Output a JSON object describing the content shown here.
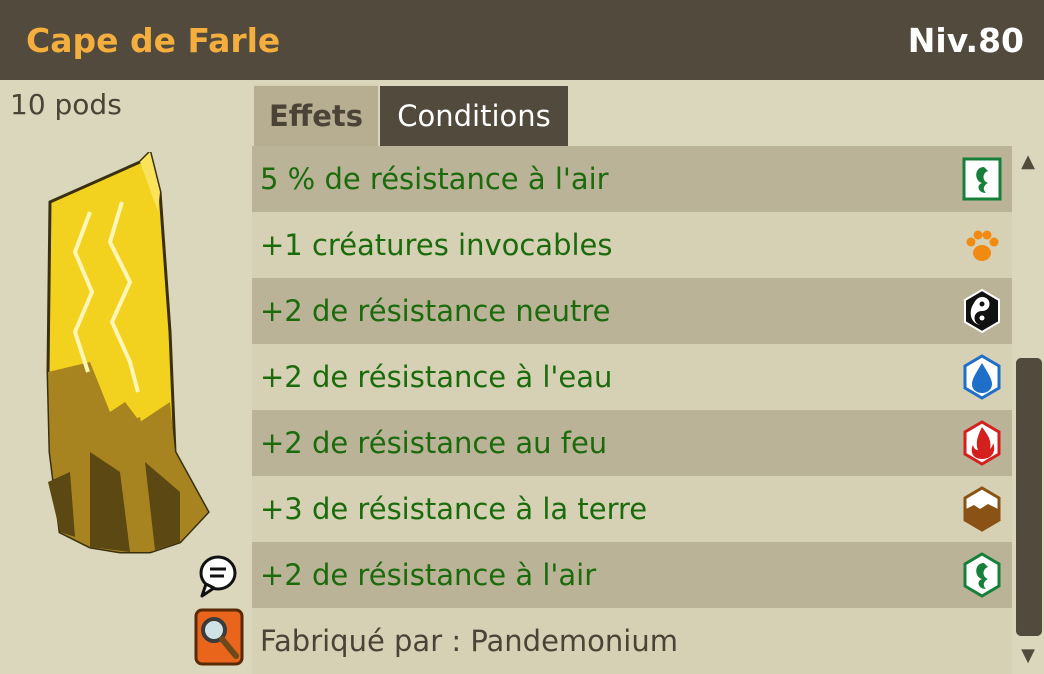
{
  "item": {
    "name": "Cape de Farle",
    "level": "Niv.80",
    "weight": "10 pods",
    "image": "yellow-cape"
  },
  "tabs": [
    {
      "label": "Effets",
      "active": true
    },
    {
      "label": "Conditions",
      "active": false
    }
  ],
  "effects": [
    {
      "text": "5 % de résistance à l'air",
      "icon": "air-resistance-percent-icon"
    },
    {
      "text": "+1 créatures invocables",
      "icon": "paw-icon"
    },
    {
      "text": "+2 de résistance neutre",
      "icon": "neutral-icon"
    },
    {
      "text": "+2 de résistance à l'eau",
      "icon": "water-icon"
    },
    {
      "text": "+2 de résistance au feu",
      "icon": "fire-icon"
    },
    {
      "text": "+3 de résistance à la terre",
      "icon": "earth-icon"
    },
    {
      "text": "+2 de résistance à l'air",
      "icon": "air-icon"
    }
  ],
  "crafter": "Fabriqué par : Pandemonium",
  "scroll": {
    "up": "▲",
    "down": "▼"
  },
  "colors": {
    "header_bg": "#514a3d",
    "name": "#f4ae3e",
    "effect_text": "#1b6b0c",
    "row_dark": "#bbb398",
    "row_light": "#d6d1b5"
  }
}
